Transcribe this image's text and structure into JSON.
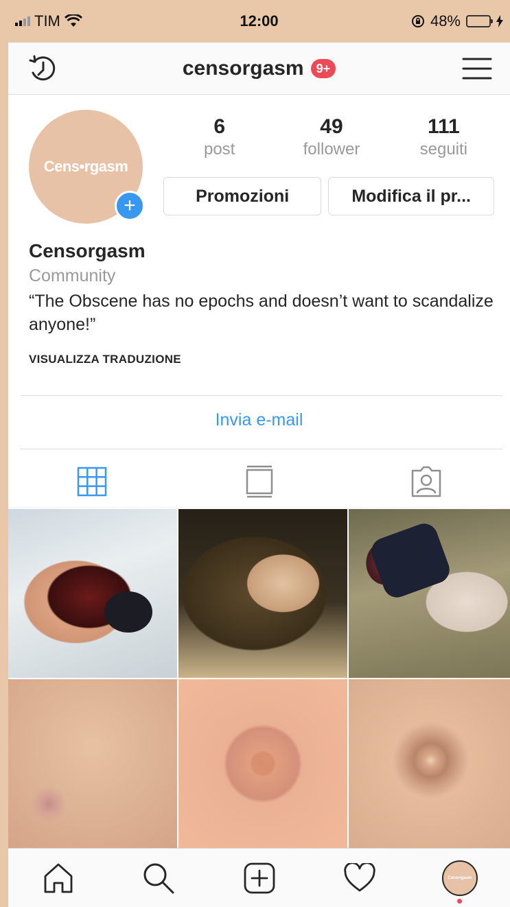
{
  "status_bar": {
    "carrier": "TIM",
    "time": "12:00",
    "battery_percent": "48%",
    "battery_level": 0.48,
    "icons": [
      "signal-icon",
      "wifi-icon",
      "rotation-lock-icon",
      "battery-icon",
      "charging-icon"
    ]
  },
  "header": {
    "username": "censorgasm",
    "notification_badge": "9+",
    "left_icon": "history-icon",
    "right_icon": "menu-icon"
  },
  "profile": {
    "avatar_text": "Cens•rgasm",
    "stats": [
      {
        "value": "6",
        "label": "post"
      },
      {
        "value": "49",
        "label": "follower"
      },
      {
        "value": "111",
        "label": "seguiti"
      }
    ],
    "buttons": {
      "promotions": "Promozioni",
      "edit_profile": "Modifica il pr..."
    },
    "name": "Censorgasm",
    "category": "Community",
    "bio": "“The Obscene has no epochs and doesn’t want to scandalize anyone!”",
    "see_translation": "VISUALIZZA TRADUZIONE",
    "email_button": "Invia e-mail"
  },
  "tabs": [
    {
      "icon": "grid-icon",
      "active": true
    },
    {
      "icon": "feed-icon",
      "active": false
    },
    {
      "icon": "tagged-icon",
      "active": false
    }
  ],
  "posts": [
    {
      "id": "post-1"
    },
    {
      "id": "post-2"
    },
    {
      "id": "post-3"
    },
    {
      "id": "post-4"
    },
    {
      "id": "post-5"
    },
    {
      "id": "post-6"
    }
  ],
  "bottom_nav": [
    "home-icon",
    "search-icon",
    "add-post-icon",
    "activity-icon",
    "profile-avatar"
  ],
  "colors": {
    "accent_blue": "#3897f0",
    "badge_red": "#ed4956",
    "avatar_bg": "#e8c2a6"
  }
}
